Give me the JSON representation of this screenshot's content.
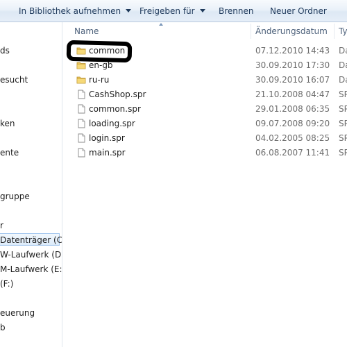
{
  "toolbar": {
    "library_label": "In Bibliothek aufnehmen",
    "share_label": "Freigeben für",
    "burn_label": "Brennen",
    "new_folder_label": "Neuer Ordner"
  },
  "nav": {
    "items": [
      {
        "label": "ds"
      },
      {
        "label": "esucht"
      },
      {
        "label": "ken"
      },
      {
        "label": "ente"
      },
      {
        "label": "gruppe"
      },
      {
        "label": "r"
      },
      {
        "label": "Datenträger (C:)",
        "selected": true
      },
      {
        "label": "W-Laufwerk (D:)"
      },
      {
        "label": "M-Laufwerk (E:)"
      },
      {
        "label": "(F:)"
      },
      {
        "label": "euerung"
      },
      {
        "label": "b"
      }
    ]
  },
  "columns": {
    "name": "Name",
    "date": "Änderungsdatum",
    "type": "Ty"
  },
  "files": [
    {
      "name": "common",
      "date": "07.12.2010 14:43",
      "type": "Da",
      "icon": "folder-icon"
    },
    {
      "name": "en-gb",
      "date": "30.09.2010 17:30",
      "type": "Da",
      "icon": "folder-icon"
    },
    {
      "name": "ru-ru",
      "date": "30.09.2010 16:07",
      "type": "Da",
      "icon": "folder-icon"
    },
    {
      "name": "CashShop.spr",
      "date": "21.10.2008 04:47",
      "type": "SP",
      "icon": "file-icon"
    },
    {
      "name": "common.spr",
      "date": "29.01.2008 06:35",
      "type": "SP",
      "icon": "file-icon"
    },
    {
      "name": "loading.spr",
      "date": "09.07.2008 09:20",
      "type": "SP",
      "icon": "file-icon"
    },
    {
      "name": "login.spr",
      "date": "04.02.2005 08:25",
      "type": "SP",
      "icon": "file-icon"
    },
    {
      "name": "main.spr",
      "date": "06.08.2007 11:41",
      "type": "SP",
      "icon": "file-icon"
    }
  ],
  "colors": {
    "toolbar_text": "#1e395b",
    "selected_bg": "#dcebfa",
    "annotation": "#000000"
  }
}
